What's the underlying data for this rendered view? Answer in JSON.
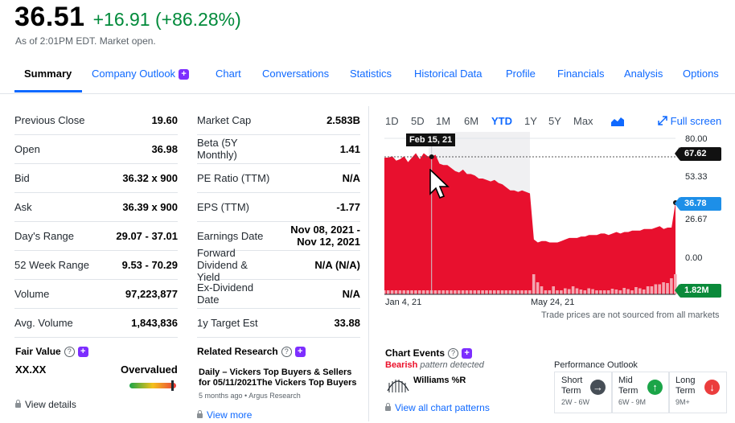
{
  "quote": {
    "price": "36.51",
    "change": "+16.91 (+86.28%)",
    "as_of": "As of 2:01PM EDT. Market open."
  },
  "tabs": [
    {
      "label": "Summary"
    },
    {
      "label": "Company Outlook"
    },
    {
      "label": "Chart"
    },
    {
      "label": "Conversations"
    },
    {
      "label": "Statistics"
    },
    {
      "label": "Historical Data"
    },
    {
      "label": "Profile"
    },
    {
      "label": "Financials"
    },
    {
      "label": "Analysis"
    },
    {
      "label": "Options"
    }
  ],
  "stats_left": [
    {
      "label": "Previous Close",
      "value": "19.60"
    },
    {
      "label": "Open",
      "value": "36.98"
    },
    {
      "label": "Bid",
      "value": "36.32 x 900"
    },
    {
      "label": "Ask",
      "value": "36.39 x 900"
    },
    {
      "label": "Day's Range",
      "value": "29.07 - 37.01"
    },
    {
      "label": "52 Week Range",
      "value": "9.53 - 70.29"
    },
    {
      "label": "Volume",
      "value": "97,223,877"
    },
    {
      "label": "Avg. Volume",
      "value": "1,843,836"
    }
  ],
  "stats_right": [
    {
      "label": "Market Cap",
      "value": "2.583B"
    },
    {
      "label": "Beta (5Y Monthly)",
      "value": "1.41"
    },
    {
      "label": "PE Ratio (TTM)",
      "value": "N/A"
    },
    {
      "label": "EPS (TTM)",
      "value": "-1.77"
    },
    {
      "label": "Earnings Date",
      "value": "Nov 08, 2021 - Nov 12, 2021"
    },
    {
      "label": "Forward Dividend & Yield",
      "value": "N/A (N/A)"
    },
    {
      "label": "Ex-Dividend Date",
      "value": "N/A"
    },
    {
      "label": "1y Target Est",
      "value": "33.88"
    }
  ],
  "fair_value": {
    "title": "Fair Value",
    "value": "XX.XX",
    "verdict": "Overvalued",
    "view_details": "View details"
  },
  "related_research": {
    "title": "Related Research",
    "headline": "Daily – Vickers Top Buyers & Sellers for 05/11/2021The Vickers Top Buyers ...",
    "meta": "5 months ago • Argus Research",
    "view_more": "View more"
  },
  "chart": {
    "ranges": [
      "1D",
      "5D",
      "1M",
      "6M",
      "YTD",
      "1Y",
      "5Y",
      "Max"
    ],
    "active_range": "YTD",
    "full_screen": "Full screen",
    "hover_date": "Feb 15, 21",
    "hover_price": "67.62",
    "current_price": "36.78",
    "current_volume": "1.82M",
    "note": "Trade prices are not sourced from all markets",
    "colors": {
      "area": "#e8102e",
      "volume": "#f4a5b0",
      "accent": "#0f69ff",
      "current": "#1d8fe8",
      "volume_tag": "#0a8a3a"
    }
  },
  "chart_data": {
    "type": "area",
    "x_tick_labels": [
      "Jan 4, 21",
      "May 24, 21"
    ],
    "y_tick_labels": [
      "80.00",
      "53.33",
      "26.67",
      "0.00"
    ],
    "ylim": [
      0,
      80
    ],
    "series": [
      {
        "values": [
          67,
          67,
          68,
          65,
          66,
          68,
          64,
          67,
          70,
          66,
          70,
          68,
          67.6,
          69,
          63,
          62,
          62,
          60,
          58,
          57,
          59,
          56,
          56,
          55,
          53,
          53,
          52,
          51,
          52,
          50,
          49,
          47,
          45,
          45,
          44,
          45,
          44,
          43,
          12,
          10,
          11,
          11,
          10,
          10,
          10,
          11,
          12,
          13,
          13,
          13,
          14,
          14,
          15,
          15,
          15,
          16,
          16,
          15,
          16,
          17,
          16,
          17,
          17,
          18,
          18,
          18,
          19,
          19,
          19,
          20,
          21,
          19,
          20,
          20,
          36.78
        ]
      },
      {
        "values": [
          1,
          1,
          1,
          1,
          1,
          1,
          1,
          1,
          1,
          1,
          1,
          1,
          1,
          1,
          1,
          1,
          1,
          1,
          1,
          1,
          1,
          1,
          1,
          1,
          1,
          1,
          1,
          1,
          1,
          1,
          1,
          1,
          1,
          1,
          1,
          1,
          1,
          1,
          5,
          3,
          2,
          1,
          1,
          2,
          1,
          1,
          1.5,
          1.3,
          2,
          1.5,
          1.2,
          1,
          1.5,
          1.3,
          1,
          1,
          1,
          1,
          1.4,
          1.2,
          1,
          1.6,
          1.3,
          1,
          1.8,
          1.5,
          1.2,
          2,
          2,
          2.5,
          2.5,
          3,
          2.8,
          4,
          5
        ]
      }
    ],
    "volume_ylim": [
      0,
      6
    ]
  },
  "chart_events": {
    "title": "Chart Events",
    "bearish": "Bearish",
    "pattern": "pattern detected",
    "indicator": "Williams %R",
    "view_all": "View all chart patterns"
  },
  "performance": {
    "title": "Performance Outlook",
    "cards": [
      {
        "term": "Short Term",
        "range": "2W - 6W",
        "arrow": "→",
        "color": "#464e56"
      },
      {
        "term": "Mid Term",
        "range": "6W - 9M",
        "arrow": "↑",
        "color": "#1ba548"
      },
      {
        "term": "Long Term",
        "range": "9M+",
        "arrow": "↓",
        "color": "#eb3d3d"
      }
    ]
  }
}
